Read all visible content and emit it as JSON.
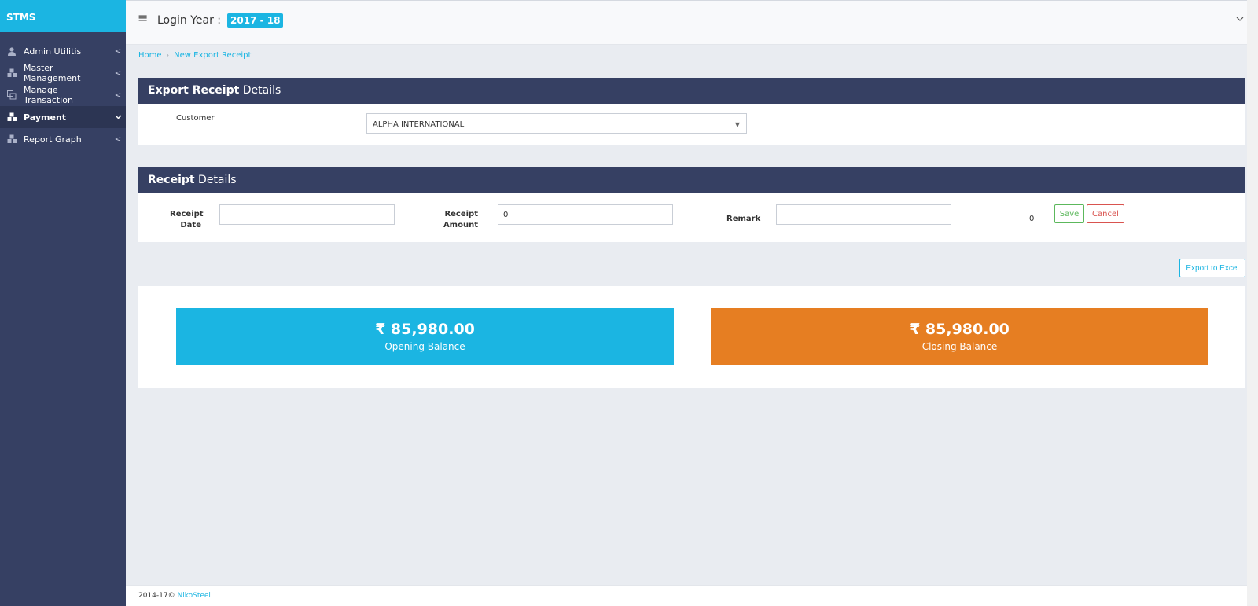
{
  "brand": "STMS",
  "sidebar": {
    "items": [
      {
        "label": "Admin Utilitis",
        "icon": "user-icon",
        "chevron": "<"
      },
      {
        "label": "Master Management",
        "icon": "cubes-icon",
        "chevron": "<"
      },
      {
        "label": "Manage Transaction",
        "icon": "copy-icon",
        "chevron": "<"
      },
      {
        "label": "Payment",
        "icon": "cubes-icon",
        "chevron": "v"
      },
      {
        "label": "Report Graph",
        "icon": "cubes-icon",
        "chevron": "<"
      }
    ]
  },
  "topbar": {
    "login_year_label": "Login Year :",
    "year_badge": "2017 - 18"
  },
  "breadcrumb": {
    "home": "Home",
    "current": "New Export Receipt"
  },
  "export_receipt": {
    "title_bold": "Export Receipt",
    "title_rest": " Details",
    "customer_label": "Customer",
    "customer_value": "ALPHA INTERNATIONAL"
  },
  "receipt_details": {
    "title_bold": "Receipt",
    "title_rest": " Details",
    "date_label_1": "Receipt",
    "date_label_2": "Date",
    "date_value": "",
    "amount_label_1": "Receipt",
    "amount_label_2": "Amount",
    "amount_value": "0",
    "remark_label": "Remark",
    "remark_value": "",
    "counter": "0",
    "save_label": "Save",
    "cancel_label": "Cancel"
  },
  "export_label": "Export to Excel",
  "balances": {
    "opening_value": "₹ 85,980.00",
    "opening_label": "Opening Balance",
    "closing_value": "₹ 85,980.00",
    "closing_label": "Closing Balance"
  },
  "footer": {
    "copyright": "2014-17©",
    "company": "NikoSteel"
  },
  "colors": {
    "accent": "#1bb5e2",
    "sidebar": "#364063",
    "closing": "#e67e22"
  }
}
